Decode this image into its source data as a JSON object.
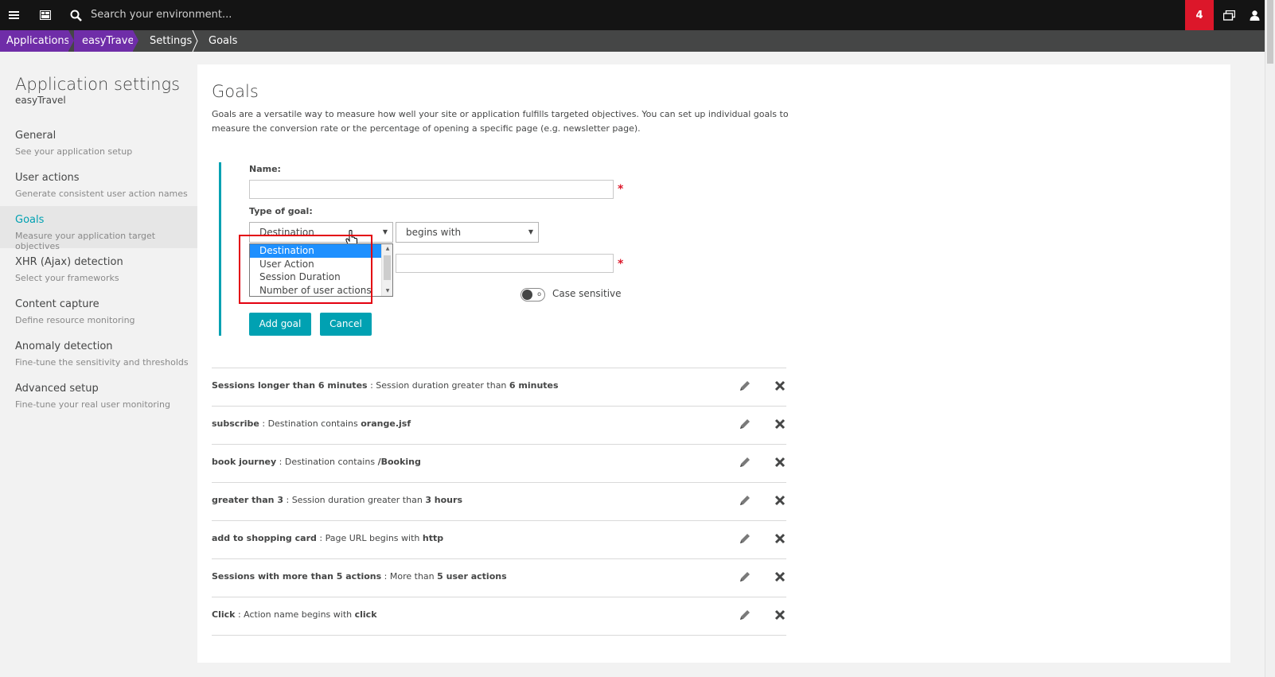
{
  "topbar": {
    "menu_icon": "hamburger-icon",
    "dashboard_icon": "dashboard-icon",
    "search_icon": "search-icon",
    "search_placeholder": "Search your environment...",
    "notification_count": "4",
    "windows_icon": "windows-icon",
    "user_icon": "user-icon"
  },
  "breadcrumb": [
    "Applications",
    "easyTravel",
    "Settings",
    "Goals"
  ],
  "sidebar": {
    "title": "Application settings",
    "subtitle": "easyTravel",
    "items": [
      {
        "label": "General",
        "desc": "See your application setup"
      },
      {
        "label": "User actions",
        "desc": "Generate consistent user action names"
      },
      {
        "label": "Goals",
        "desc": "Measure your application target objectives"
      },
      {
        "label": "XHR (Ajax) detection",
        "desc": "Select your frameworks"
      },
      {
        "label": "Content capture",
        "desc": "Define resource monitoring"
      },
      {
        "label": "Anomaly detection",
        "desc": "Fine-tune the sensitivity and thresholds"
      },
      {
        "label": "Advanced setup",
        "desc": "Fine-tune your real user monitoring"
      }
    ],
    "active_index": 2
  },
  "main": {
    "title": "Goals",
    "intro": "Goals are a versatile way to measure how well your site or application fulfills targeted objectives. You can set up individual goals to measure the conversion rate or the percentage of opening a specific page (e.g. newsletter page).",
    "form": {
      "name_label": "Name:",
      "name_value": "",
      "type_label": "Type of goal:",
      "type_selected": "Destination",
      "condition_selected": "begins with",
      "value_field": "",
      "required_mark": "*",
      "type_options": [
        "Destination",
        "User Action",
        "Session Duration",
        "Number of user actions"
      ],
      "case_sensitive_label": "Case sensitive",
      "toggle_off_glyph": "o",
      "add_button": "Add goal",
      "cancel_button": "Cancel"
    },
    "goals": [
      {
        "name": "Sessions longer than 6 minutes",
        "sep": " : ",
        "desc": "Session duration greater than ",
        "value": "6 minutes"
      },
      {
        "name": "subscribe",
        "sep": " : ",
        "desc": "Destination contains ",
        "value": "orange.jsf"
      },
      {
        "name": "book journey",
        "sep": " : ",
        "desc": "Destination contains ",
        "value": "/Booking"
      },
      {
        "name": "greater than 3",
        "sep": " : ",
        "desc": "Session duration greater than ",
        "value": "3 hours"
      },
      {
        "name": "add to shopping card",
        "sep": " : ",
        "desc": "Page URL begins with ",
        "value": "http"
      },
      {
        "name": "Sessions with more than 5 actions",
        "sep": " : ",
        "desc": "More than ",
        "value": "5 user actions"
      },
      {
        "name": "Click",
        "sep": " : ",
        "desc": "Action name begins with ",
        "value": "click"
      }
    ]
  },
  "colors": {
    "accent": "#00a1b2",
    "breadcrumb_purple": "#6f2da8",
    "notification_red": "#dc172a",
    "highlight_red": "#e3000f"
  }
}
